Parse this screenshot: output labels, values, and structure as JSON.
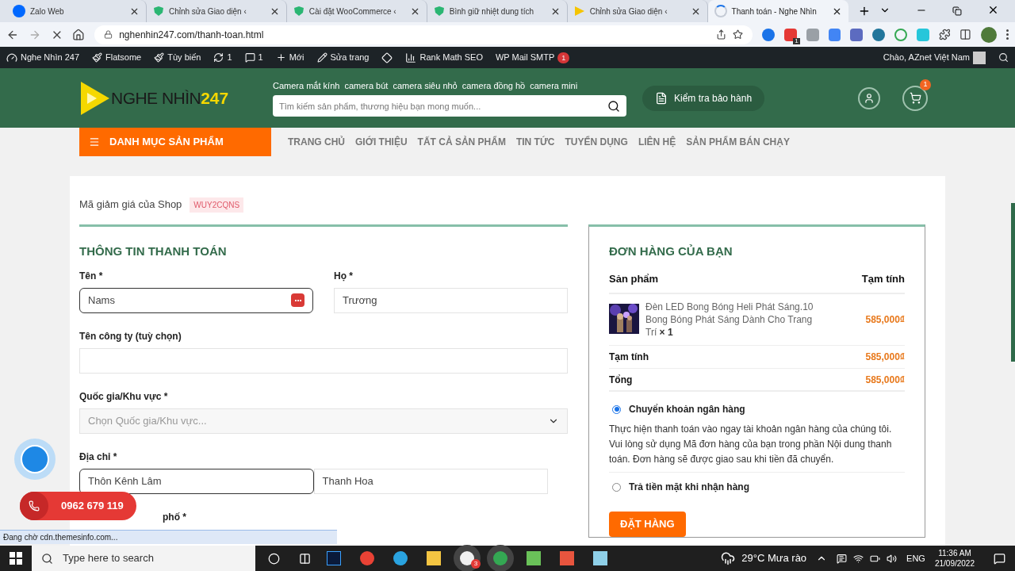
{
  "browser": {
    "tabs": [
      {
        "title": "Zalo Web",
        "selected": false,
        "loading": false
      },
      {
        "title": "Chỉnh sửa Giao diện ‹",
        "selected": false,
        "loading": false
      },
      {
        "title": "Cài đặt WooCommerce ‹",
        "selected": false,
        "loading": false
      },
      {
        "title": "Bình giữ nhiệt dung tích",
        "selected": false,
        "loading": false
      },
      {
        "title": "Chỉnh sửa Giao diện ‹",
        "selected": false,
        "loading": false
      },
      {
        "title": "Thanh toán - Nghe Nhìn",
        "selected": true,
        "loading": true
      }
    ],
    "url": "nghenhin247.com/thanh-toan.html",
    "extension_badge": "1"
  },
  "admin_bar": {
    "site": "Nghe Nhìn 247",
    "items": [
      {
        "label": "Flatsome"
      },
      {
        "label": "Tùy biến"
      },
      {
        "label": "1"
      },
      {
        "label": "1"
      },
      {
        "label": "Mới"
      },
      {
        "label": "Sửa trang"
      }
    ],
    "plugins": [
      {
        "label": "Rank Math SEO"
      },
      {
        "label": "WP Mail SMTP",
        "badge": "1"
      }
    ],
    "greeting": "Chào, AZnet Việt Nam"
  },
  "header": {
    "logo_main": "NGHE NHÌN",
    "logo_accent": "247",
    "quick_links": [
      "Camera mắt kính",
      "camera bút",
      "camera siêu nhỏ",
      "camera đồng hồ",
      "camera mini"
    ],
    "search_placeholder": "Tìm kiếm sản phẩm, thương hiệu bạn mong muốn...",
    "warranty_button": "Kiểm tra bảo hành",
    "cart_badge": "1"
  },
  "nav": {
    "category_button": "DANH MỤC SẢN PHẨM",
    "items": [
      "TRANG CHỦ",
      "GIỚI THIỆU",
      "TẤT CẢ SẢN PHẨM",
      "TIN TỨC",
      "TUYỂN DỤNG",
      "LIÊN HỆ",
      "SẢN PHẨM BÁN CHẠY"
    ]
  },
  "coupon": {
    "label": "Mã giảm giá của Shop",
    "code": "WUY2CQNS"
  },
  "billing": {
    "title": "THÔNG TIN THANH TOÁN",
    "rows": [
      {
        "fields": [
          {
            "kind": "input",
            "label": "Tên *",
            "value": "Nams",
            "focused": true,
            "autofill_icon": true
          },
          {
            "kind": "input",
            "label": "Họ *",
            "value": "Trương",
            "focused": false,
            "autofill_icon": false
          }
        ]
      },
      {
        "fields": [
          {
            "kind": "input",
            "label": "Tên công ty (tuỳ chọn)",
            "focused": false,
            "autofill_icon": false
          }
        ]
      },
      {
        "fields": [
          {
            "kind": "select",
            "label": "Quốc gia/Khu vực *",
            "placeholder": "Chọn Quốc gia/Khu vực...",
            "focused": false
          }
        ]
      },
      {
        "fields": [
          {
            "kind": "address",
            "label": "Địa chỉ *",
            "value": "Thôn Kênh Lâm",
            "focused": true,
            "autofill_icon": false
          },
          {
            "kind": "address",
            "value": "Thanh Hoa",
            "focused": false,
            "autofill_icon": false
          }
        ]
      },
      {
        "fields": [
          {
            "kind": "label",
            "label": "phố *"
          }
        ]
      }
    ]
  },
  "order": {
    "title": "ĐƠN HÀNG CỦA BẠN",
    "columns": [
      "Sản phẩm",
      "Tạm tính"
    ],
    "items": [
      {
        "name": "Đèn LED Bong Bóng Heli Phát Sáng.10 Bong Bóng Phát Sáng Dành Cho Trang Trí",
        "qty": "× 1",
        "price": "585,000₫"
      }
    ],
    "totals": [
      {
        "label": "Tạm tính",
        "value": "585,000₫"
      },
      {
        "label": "Tổng",
        "value": "585,000₫"
      }
    ],
    "payment_methods": [
      {
        "label": "Chuyển khoản ngân hàng",
        "selected": true,
        "description": "Thực hiện thanh toán vào ngay tài khoản ngân hàng của chúng tôi. Vui lòng sử dụng Mã đơn hàng của bạn trong phần Nội dung thanh toán. Đơn hàng sẽ được giao sau khi tiền đã chuyển."
      },
      {
        "label": "Trả tiền mặt khi nhận hàng",
        "selected": false
      }
    ],
    "submit": "ĐẶT HÀNG"
  },
  "floating": {
    "phone": "0962 679 119"
  },
  "status_bar": "Đang chờ cdn.themesinfo.com...",
  "taskbar": {
    "search_placeholder": "Type here to search",
    "app_badge": "3",
    "weather": "29°C Mưa rào",
    "language": "ENG",
    "time": "11:36 AM",
    "date": "21/09/2022"
  }
}
